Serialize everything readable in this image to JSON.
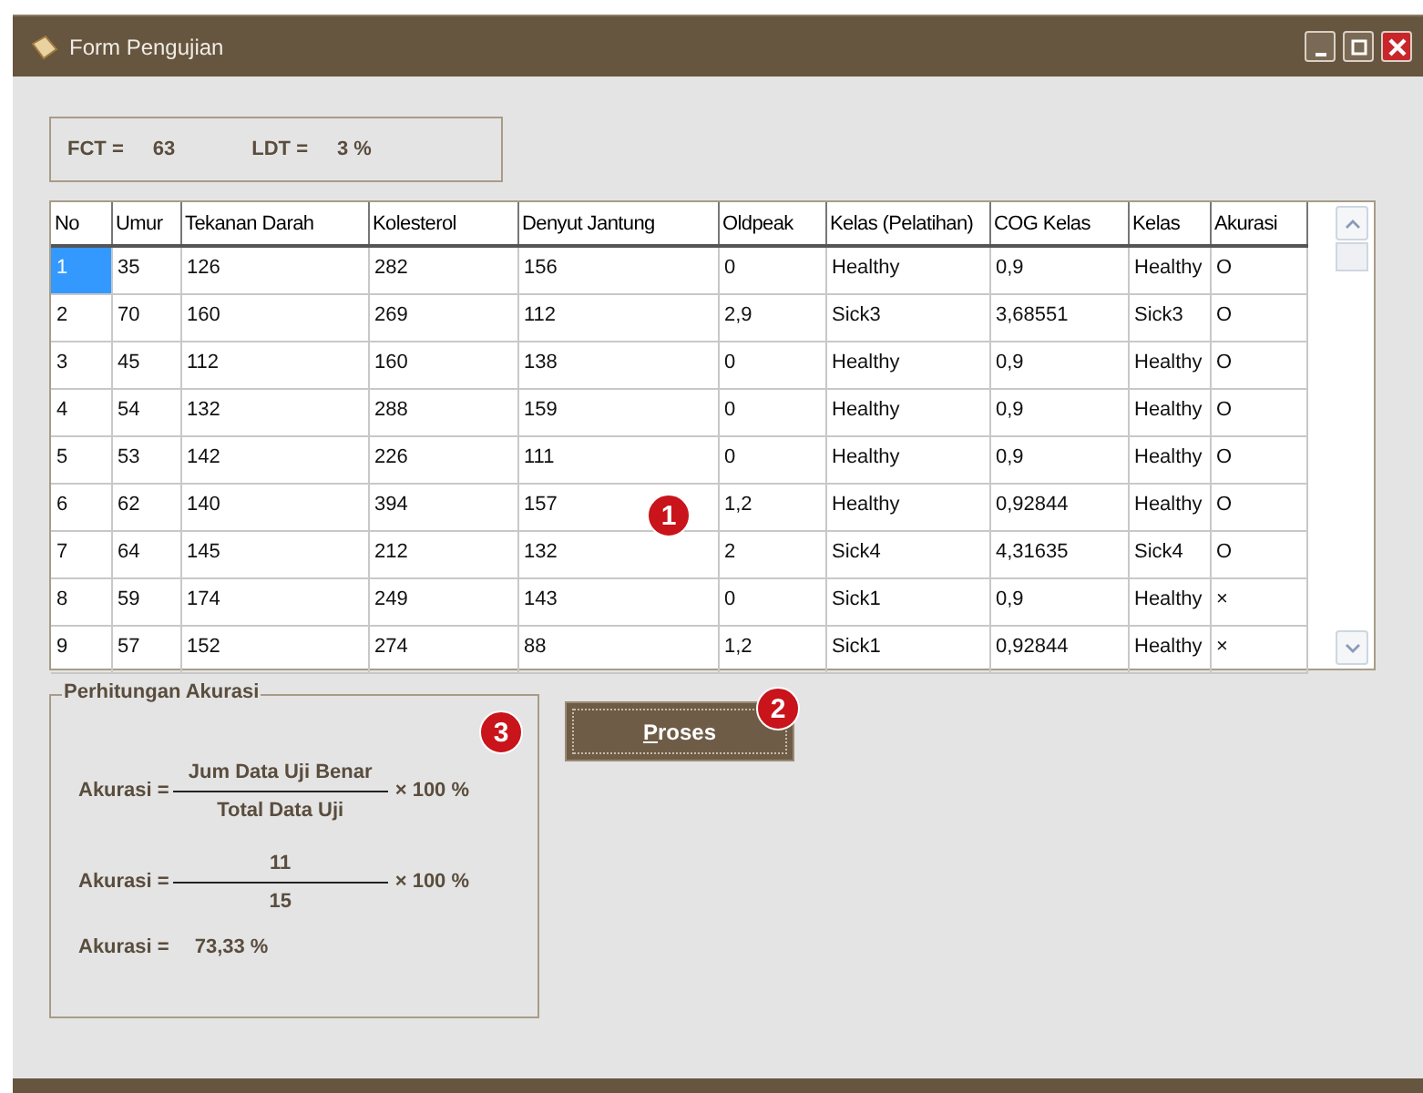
{
  "window": {
    "title": "Form Pengujian"
  },
  "summary": [
    {
      "label": "FCT =",
      "value": "63"
    },
    {
      "label": "LDT =",
      "value": "3 %"
    }
  ],
  "table": {
    "columns": [
      "No",
      "Umur",
      "Tekanan Darah",
      "Kolesterol",
      "Denyut Jantung",
      "Oldpeak",
      "Kelas (Pelatihan)",
      "COG Kelas",
      "Kelas",
      "Akurasi"
    ],
    "rows": [
      {
        "selected": true,
        "cells": [
          "1",
          "35",
          "126",
          "282",
          "156",
          "0",
          "Healthy",
          "0,9",
          "Healthy",
          "O"
        ]
      },
      {
        "selected": false,
        "cells": [
          "2",
          "70",
          "160",
          "269",
          "112",
          "2,9",
          "Sick3",
          "3,68551",
          "Sick3",
          "O"
        ]
      },
      {
        "selected": false,
        "cells": [
          "3",
          "45",
          "112",
          "160",
          "138",
          "0",
          "Healthy",
          "0,9",
          "Healthy",
          "O"
        ]
      },
      {
        "selected": false,
        "cells": [
          "4",
          "54",
          "132",
          "288",
          "159",
          "0",
          "Healthy",
          "0,9",
          "Healthy",
          "O"
        ]
      },
      {
        "selected": false,
        "cells": [
          "5",
          "53",
          "142",
          "226",
          "111",
          "0",
          "Healthy",
          "0,9",
          "Healthy",
          "O"
        ]
      },
      {
        "selected": false,
        "cells": [
          "6",
          "62",
          "140",
          "394",
          "157",
          "1,2",
          "Healthy",
          "0,92844",
          "Healthy",
          "O"
        ]
      },
      {
        "selected": false,
        "cells": [
          "7",
          "64",
          "145",
          "212",
          "132",
          "2",
          "Sick4",
          "4,31635",
          "Sick4",
          "O"
        ]
      },
      {
        "selected": false,
        "cells": [
          "8",
          "59",
          "174",
          "249",
          "143",
          "0",
          "Sick1",
          "0,9",
          "Healthy",
          "×"
        ]
      },
      {
        "selected": false,
        "cells": [
          "9",
          "57",
          "152",
          "274",
          "88",
          "1,2",
          "Sick1",
          "0,92844",
          "Healthy",
          "×"
        ]
      }
    ]
  },
  "accuracy_panel": {
    "title": "Perhitungan Akurasi",
    "lines": [
      {
        "kind": "fraction",
        "label": "Akurasi =",
        "numerator": "Jum Data Uji Benar",
        "denominator": "Total Data Uji",
        "factor": "× 100 %"
      },
      {
        "kind": "fraction",
        "label": "Akurasi =",
        "numerator": "11",
        "denominator": "15",
        "factor": "× 100 %"
      },
      {
        "kind": "result",
        "label": "Akurasi =",
        "value": "73,33 %"
      }
    ]
  },
  "process_button": "Proses",
  "callouts": [
    "1",
    "2",
    "3"
  ]
}
